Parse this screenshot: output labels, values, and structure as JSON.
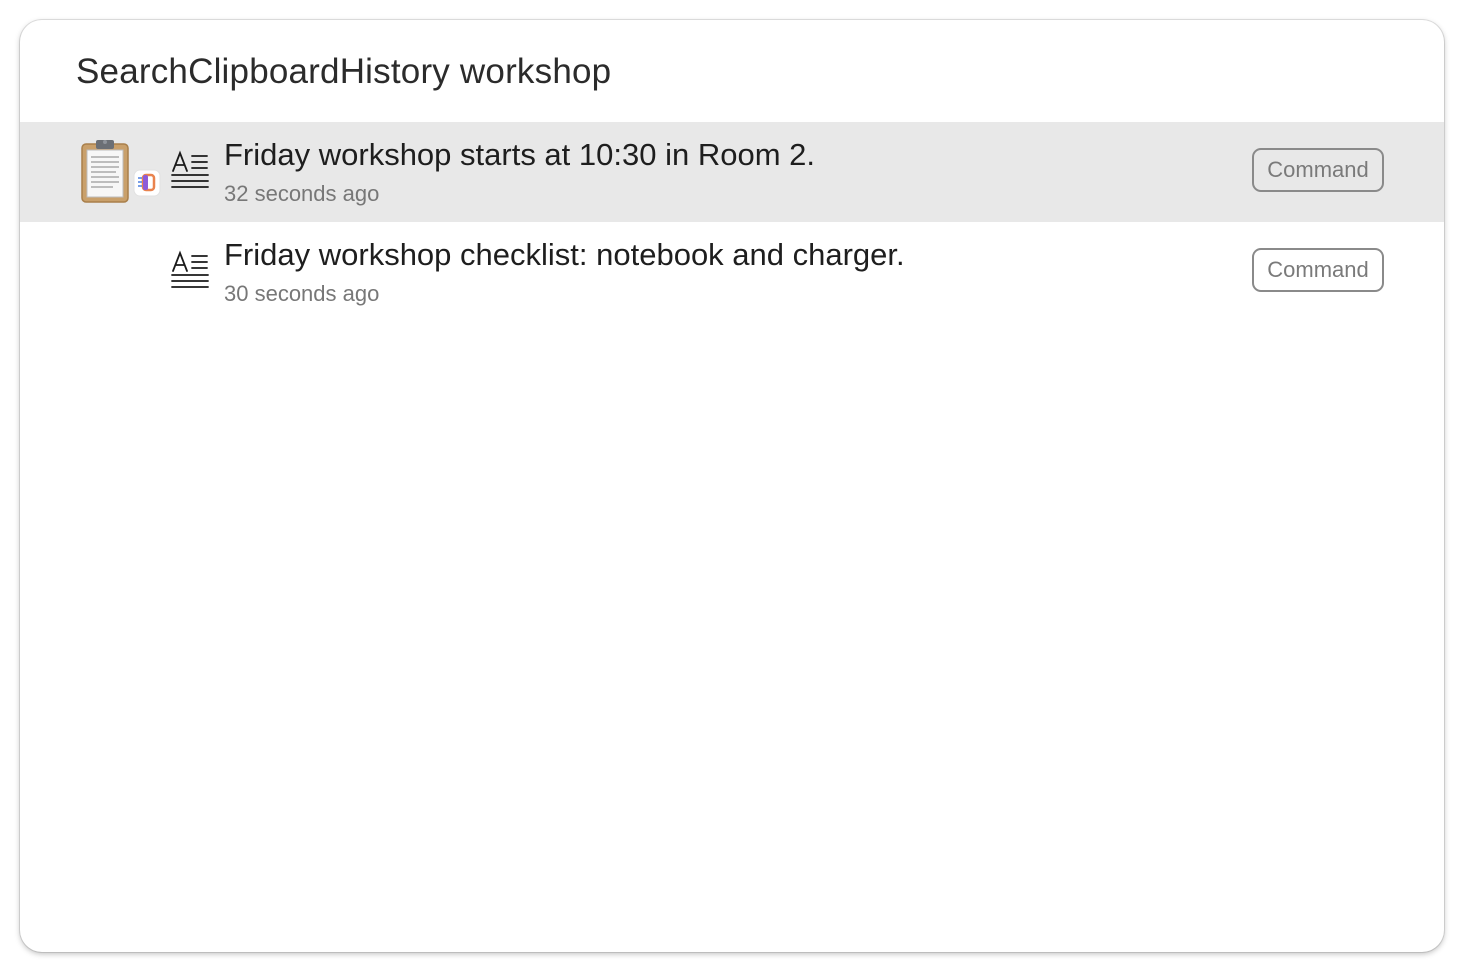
{
  "search": {
    "query": "SearchClipboardHistory workshop"
  },
  "results": [
    {
      "title": "Friday workshop starts at 10:30 in Room 2.",
      "subtitle": "32 seconds ago",
      "action_label": "Command",
      "selected": true,
      "app_icon": "clipboard-icon",
      "type_icon": "text-lines-icon"
    },
    {
      "title": "Friday workshop checklist: notebook and charger.",
      "subtitle": "30 seconds ago",
      "action_label": "Command",
      "selected": false,
      "type_icon": "text-lines-icon"
    }
  ],
  "colors": {
    "selected_row": "#e8e8e8",
    "button_border": "#8a8a8a",
    "subtitle": "#777777"
  }
}
